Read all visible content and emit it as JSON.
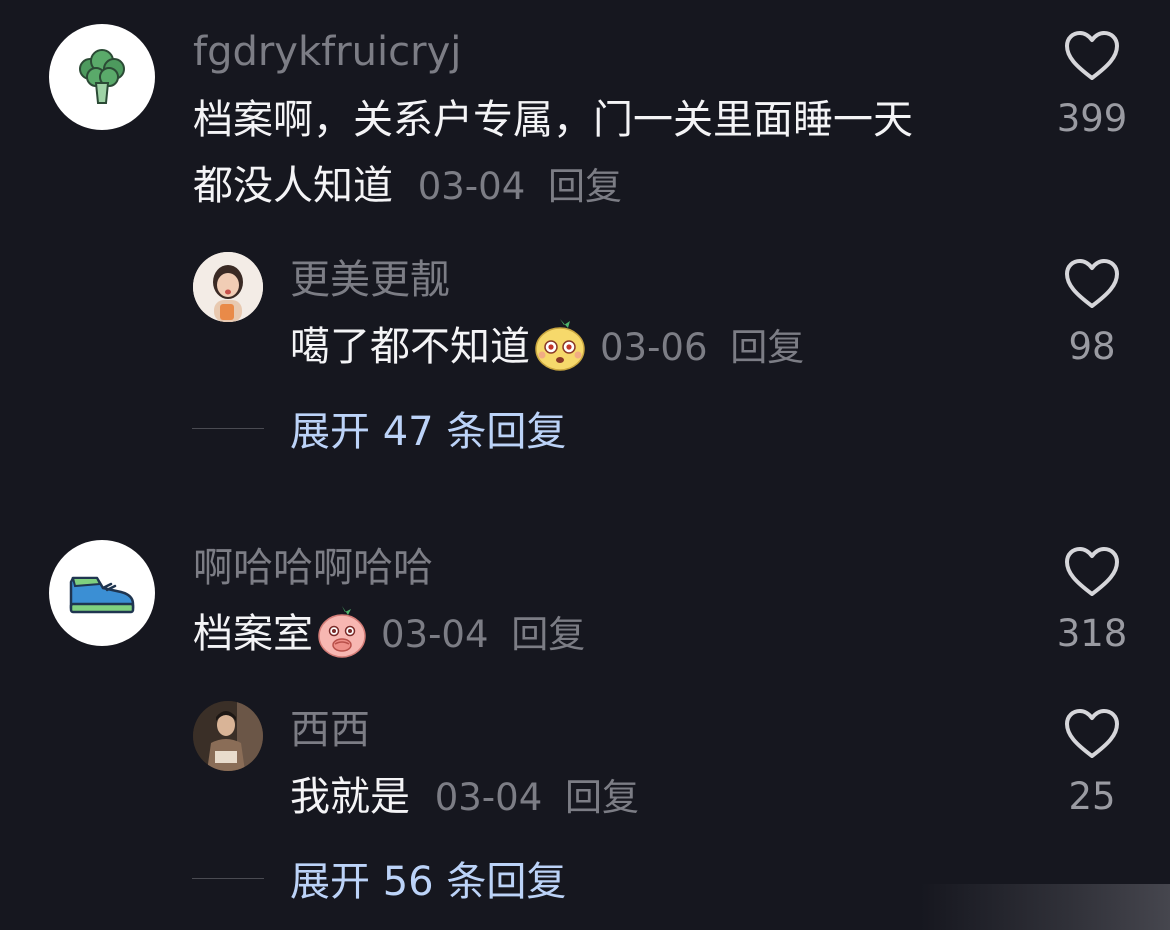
{
  "colors": {
    "background": "#16171f",
    "username": "#7c7d85",
    "text": "#f4f4f6",
    "meta": "#7c7d85",
    "expand_link": "#bcd3f8",
    "likes": "#9a9ba2"
  },
  "threads": [
    {
      "comment": {
        "avatar_icon": "broccoli-icon",
        "username": "fgdrykfruicryj",
        "text_line1": "档案啊，关系户专属，门一关里面睡一天",
        "text_line2": "都没人知道",
        "date": "03-04",
        "reply_label": "回复",
        "likes": "399"
      },
      "reply": {
        "avatar_icon": "girl-photo-avatar",
        "username": "更美更靓",
        "text": "噶了都不知道",
        "emoji": "dizzy-face-emoji",
        "date": "03-06",
        "reply_label": "回复",
        "likes": "98"
      },
      "expand_label": "展开 47 条回复"
    },
    {
      "comment": {
        "avatar_icon": "sneaker-icon",
        "username": "啊哈哈啊哈哈",
        "text": "档案室",
        "emoji": "covering-mouth-emoji",
        "date": "03-04",
        "reply_label": "回复",
        "likes": "318"
      },
      "reply": {
        "avatar_icon": "man-photo-avatar",
        "username": "西西",
        "text": "我就是",
        "date": "03-04",
        "reply_label": "回复",
        "likes": "25"
      },
      "expand_label": "展开 56 条回复"
    }
  ]
}
